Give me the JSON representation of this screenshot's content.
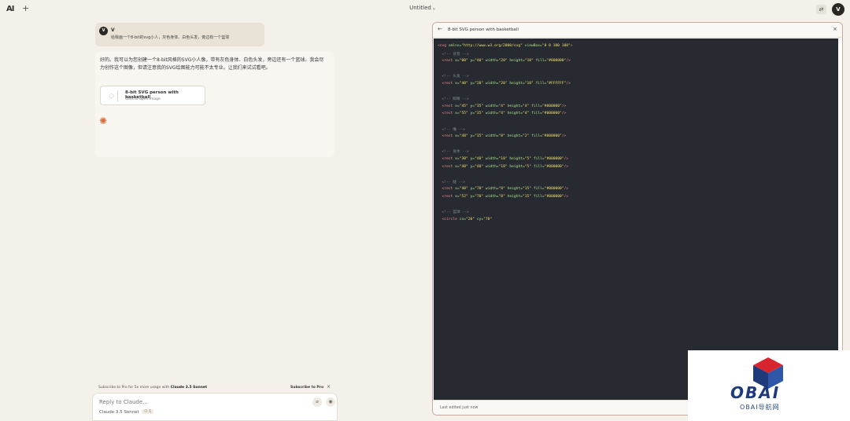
{
  "topbar": {
    "logo": "AI",
    "new_chat": "+",
    "doc_title": "Untitled",
    "chevron": "⌄",
    "settings_icon": "⇄",
    "user_initial": "V"
  },
  "chat": {
    "user_name": "V",
    "user_initial": "V",
    "user_message": "给我画一个8-bit的svg小人，灰色身体、白色头发，旁边有一个篮球",
    "assistant_text": "好的。我可以为您创建一个8-bit风格的SVG小人像，带有灰色身体、白色头发，旁边还有一个篮球。我会尽力创作这个图像，但请注意我的SVG绘图能力可能不太专业。让我们来试试看吧。",
    "artifact_title": "8-bit SVG person with basketball",
    "artifact_subtitle": "Click to open image",
    "spinner": "◌",
    "claude_mark": "✺"
  },
  "subscribe": {
    "prefix": "Subscribe to Pro for 5x more usage with ",
    "model": "Claude 3.5 Sonnet",
    "link": "Subscribe to Pro",
    "close": "×"
  },
  "composer": {
    "placeholder": "Reply to Claude...",
    "model_name": "Claude 3.5 Sonnet",
    "model_tag": "⚇ 1",
    "attach_icon": "⌀",
    "send_icon": "◉"
  },
  "panel": {
    "back": "←",
    "title": "8-bit SVG person with basketball",
    "close": "×",
    "footer": "Last edited just now",
    "code_lines": [
      [
        [
          "c-tag",
          "<svg "
        ],
        [
          "c-attr",
          "xmlns="
        ],
        [
          "c-str",
          "\"http://www.w3.org/2000/svg\""
        ],
        [
          "c-attr",
          " viewBox="
        ],
        [
          "c-str",
          "\"0 0 100 100\""
        ],
        [
          "c-tag",
          ">"
        ]
      ],
      [
        [
          "c-com",
          "  <!-- 背景 -->"
        ]
      ],
      [
        [
          "c-tag",
          "  <rect "
        ],
        [
          "c-attr",
          "x="
        ],
        [
          "c-str",
          "\"00\""
        ],
        [
          "c-attr",
          " y="
        ],
        [
          "c-str",
          "\"40\""
        ],
        [
          "c-attr",
          " width="
        ],
        [
          "c-str",
          "\"20\""
        ],
        [
          "c-attr",
          " height="
        ],
        [
          "c-str",
          "\"10\""
        ],
        [
          "c-attr",
          " fill="
        ],
        [
          "c-str",
          "\"#000000\""
        ],
        [
          "c-tag",
          "/>"
        ]
      ],
      [
        [
          "c-plain",
          ""
        ]
      ],
      [
        [
          "c-com",
          "  <!-- 头发 -->"
        ]
      ],
      [
        [
          "c-tag",
          "  <rect "
        ],
        [
          "c-attr",
          "x="
        ],
        [
          "c-str",
          "\"40\""
        ],
        [
          "c-attr",
          " y="
        ],
        [
          "c-str",
          "\"20\""
        ],
        [
          "c-attr",
          " width="
        ],
        [
          "c-str",
          "\"20\""
        ],
        [
          "c-attr",
          " height="
        ],
        [
          "c-str",
          "\"10\""
        ],
        [
          "c-attr",
          " fill="
        ],
        [
          "c-str",
          "\"#FFFFFF\""
        ],
        [
          "c-tag",
          "/>"
        ]
      ],
      [
        [
          "c-plain",
          ""
        ]
      ],
      [
        [
          "c-com",
          "  <!-- 眼睛 -->"
        ]
      ],
      [
        [
          "c-tag",
          "  <rect "
        ],
        [
          "c-attr",
          "x="
        ],
        [
          "c-str",
          "\"45\""
        ],
        [
          "c-attr",
          " y="
        ],
        [
          "c-str",
          "\"35\""
        ],
        [
          "c-attr",
          " width="
        ],
        [
          "c-str",
          "\"4\""
        ],
        [
          "c-attr",
          " height="
        ],
        [
          "c-str",
          "\"4\""
        ],
        [
          "c-attr",
          " fill="
        ],
        [
          "c-str",
          "\"#000000\""
        ],
        [
          "c-tag",
          "/>"
        ]
      ],
      [
        [
          "c-tag",
          "  <rect "
        ],
        [
          "c-attr",
          "x="
        ],
        [
          "c-str",
          "\"55\""
        ],
        [
          "c-attr",
          " y="
        ],
        [
          "c-str",
          "\"35\""
        ],
        [
          "c-attr",
          " width="
        ],
        [
          "c-str",
          "\"4\""
        ],
        [
          "c-attr",
          " height="
        ],
        [
          "c-str",
          "\"4\""
        ],
        [
          "c-attr",
          " fill="
        ],
        [
          "c-str",
          "\"#000000\""
        ],
        [
          "c-tag",
          "/>"
        ]
      ],
      [
        [
          "c-plain",
          ""
        ]
      ],
      [
        [
          "c-com",
          "  <!-- 嘴 -->"
        ]
      ],
      [
        [
          "c-tag",
          "  <rect "
        ],
        [
          "c-attr",
          "x="
        ],
        [
          "c-str",
          "\"48\""
        ],
        [
          "c-attr",
          " y="
        ],
        [
          "c-str",
          "\"35\""
        ],
        [
          "c-attr",
          " width="
        ],
        [
          "c-str",
          "\"8\""
        ],
        [
          "c-attr",
          " height="
        ],
        [
          "c-str",
          "\"2\""
        ],
        [
          "c-attr",
          " fill="
        ],
        [
          "c-str",
          "\"#000000\""
        ],
        [
          "c-tag",
          "/>"
        ]
      ],
      [
        [
          "c-plain",
          ""
        ]
      ],
      [
        [
          "c-com",
          "  <!-- 身体 -->"
        ]
      ],
      [
        [
          "c-tag",
          "  <rect "
        ],
        [
          "c-attr",
          "x="
        ],
        [
          "c-str",
          "\"30\""
        ],
        [
          "c-attr",
          " y="
        ],
        [
          "c-str",
          "\"40\""
        ],
        [
          "c-attr",
          " width="
        ],
        [
          "c-str",
          "\"10\""
        ],
        [
          "c-attr",
          " height="
        ],
        [
          "c-str",
          "\"5\""
        ],
        [
          "c-attr",
          " fill="
        ],
        [
          "c-str",
          "\"#000000\""
        ],
        [
          "c-tag",
          "/>"
        ]
      ],
      [
        [
          "c-tag",
          "  <rect "
        ],
        [
          "c-attr",
          "x="
        ],
        [
          "c-str",
          "\"40\""
        ],
        [
          "c-attr",
          " y="
        ],
        [
          "c-str",
          "\"40\""
        ],
        [
          "c-attr",
          " width="
        ],
        [
          "c-str",
          "\"10\""
        ],
        [
          "c-attr",
          " height="
        ],
        [
          "c-str",
          "\"5\""
        ],
        [
          "c-attr",
          " fill="
        ],
        [
          "c-str",
          "\"#000000\""
        ],
        [
          "c-tag",
          "/>"
        ]
      ],
      [
        [
          "c-plain",
          ""
        ]
      ],
      [
        [
          "c-com",
          "  <!-- 腿 -->"
        ]
      ],
      [
        [
          "c-tag",
          "  <rect "
        ],
        [
          "c-attr",
          "x="
        ],
        [
          "c-str",
          "\"40\""
        ],
        [
          "c-attr",
          " y="
        ],
        [
          "c-str",
          "\"70\""
        ],
        [
          "c-attr",
          " width="
        ],
        [
          "c-str",
          "\"8\""
        ],
        [
          "c-attr",
          " height="
        ],
        [
          "c-str",
          "\"15\""
        ],
        [
          "c-attr",
          " fill="
        ],
        [
          "c-str",
          "\"#000000\""
        ],
        [
          "c-tag",
          "/>"
        ]
      ],
      [
        [
          "c-tag",
          "  <rect "
        ],
        [
          "c-attr",
          "x="
        ],
        [
          "c-str",
          "\"52\""
        ],
        [
          "c-attr",
          " y="
        ],
        [
          "c-str",
          "\"70\""
        ],
        [
          "c-attr",
          " width="
        ],
        [
          "c-str",
          "\"8\""
        ],
        [
          "c-attr",
          " height="
        ],
        [
          "c-str",
          "\"15\""
        ],
        [
          "c-attr",
          " fill="
        ],
        [
          "c-str",
          "\"#000000\""
        ],
        [
          "c-tag",
          "/>"
        ]
      ],
      [
        [
          "c-plain",
          ""
        ]
      ],
      [
        [
          "c-com",
          "  <!-- 篮球 -->"
        ]
      ],
      [
        [
          "c-tag",
          "  <circle "
        ],
        [
          "c-attr",
          "cx="
        ],
        [
          "c-str",
          "\"20\""
        ],
        [
          "c-attr",
          " cy="
        ],
        [
          "c-str",
          "\"70\""
        ]
      ]
    ]
  },
  "watermark": {
    "brand": "OBAI",
    "sub": "OBAI导航网"
  }
}
